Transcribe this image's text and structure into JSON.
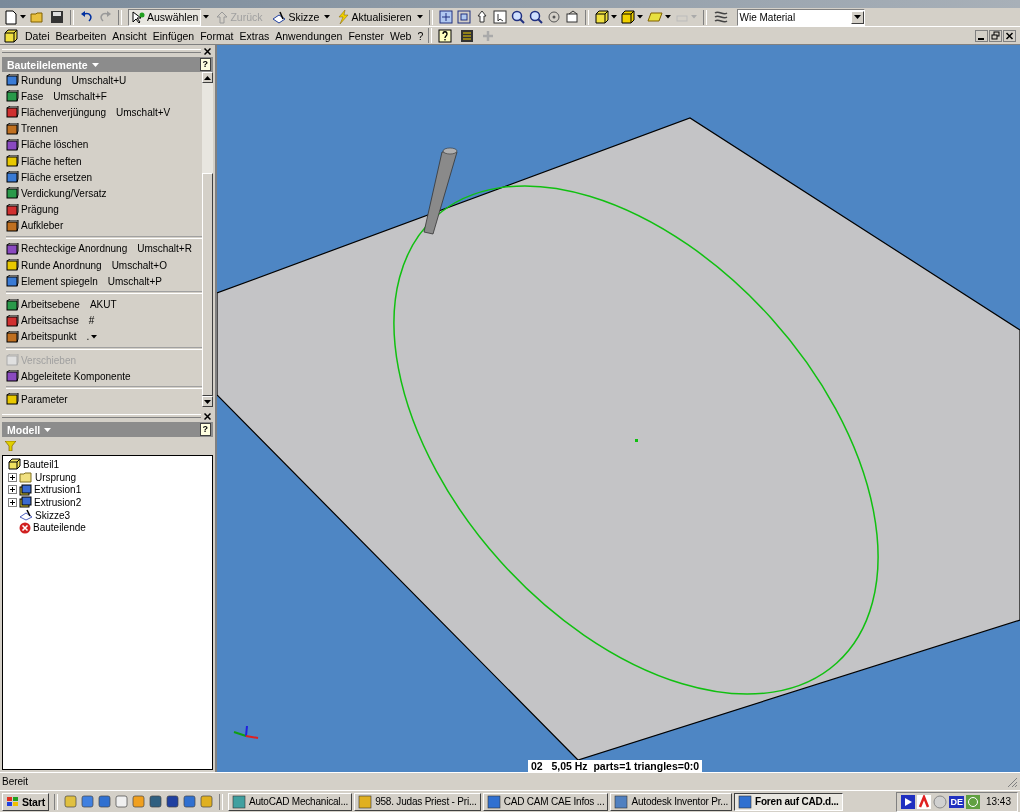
{
  "toolbar": {
    "buttons": [
      {
        "label": "Auswählen",
        "selected": true,
        "disabled": false
      },
      {
        "label": "Zurück",
        "selected": false,
        "disabled": true
      },
      {
        "label": "Skizze",
        "selected": false,
        "disabled": false
      },
      {
        "label": "Aktualisieren",
        "selected": false,
        "disabled": false
      }
    ],
    "material": {
      "value": "Wie Material"
    }
  },
  "menu": [
    "Datei",
    "Bearbeiten",
    "Ansicht",
    "Einfügen",
    "Format",
    "Extras",
    "Anwendungen",
    "Fenster",
    "Web",
    "?"
  ],
  "features_panel": {
    "title": "Bauteilelemente",
    "help": "?",
    "groups": [
      [
        {
          "label": "Rundung",
          "shortcut": "Umschalt+U",
          "disabled": false
        },
        {
          "label": "Fase",
          "shortcut": "Umschalt+F",
          "disabled": false
        },
        {
          "label": "Flächenverjüngung",
          "shortcut": "Umschalt+V",
          "disabled": false
        },
        {
          "label": "Trennen",
          "disabled": false
        },
        {
          "label": "Fläche löschen",
          "disabled": false
        },
        {
          "label": "Fläche heften",
          "disabled": false
        },
        {
          "label": "Fläche ersetzen",
          "disabled": false
        },
        {
          "label": "Verdickung/Versatz",
          "disabled": false
        },
        {
          "label": "Prägung",
          "disabled": false
        },
        {
          "label": "Aufkleber",
          "disabled": false
        }
      ],
      [
        {
          "label": "Rechteckige Anordnung",
          "shortcut": "Umschalt+R",
          "disabled": false
        },
        {
          "label": "Runde Anordnung",
          "shortcut": "Umschalt+O",
          "disabled": false
        },
        {
          "label": "Element spiegeln",
          "shortcut": "Umschalt+P",
          "disabled": false
        }
      ],
      [
        {
          "label": "Arbeitsebene",
          "shortcut": "AKUT",
          "disabled": false
        },
        {
          "label": "Arbeitsachse",
          "shortcut": "#",
          "disabled": false
        },
        {
          "label": "Arbeitspunkt",
          "shortcut": ".",
          "dropdown": true,
          "disabled": false
        }
      ],
      [
        {
          "label": "Verschieben",
          "disabled": true
        },
        {
          "label": "Abgeleitete Komponente",
          "disabled": false
        }
      ],
      [
        {
          "label": "Parameter",
          "disabled": false
        }
      ]
    ]
  },
  "model_panel": {
    "title": "Modell",
    "help": "?",
    "tree": [
      {
        "label": "Bauteil1",
        "kind": "part",
        "children": [
          {
            "label": "Ursprung",
            "kind": "folder",
            "expanded": false
          },
          {
            "label": "Extrusion1",
            "kind": "feature",
            "expanded": false
          },
          {
            "label": "Extrusion2",
            "kind": "feature",
            "expanded": false
          },
          {
            "label": "Skizze3",
            "kind": "sketch"
          },
          {
            "label": "Bauteilende",
            "kind": "end"
          }
        ]
      }
    ]
  },
  "viewport": {
    "info": "02   5,05 Hz  parts=1 triangles=0:0"
  },
  "status_bar": {
    "text": "Bereit"
  },
  "taskbar": {
    "start": "Start",
    "tasks": [
      {
        "label": "AutoCAD Mechanical...",
        "selected": false
      },
      {
        "label": "958. Judas Priest - Pri...",
        "selected": false
      },
      {
        "label": "CAD CAM CAE Infos ...",
        "selected": false
      },
      {
        "label": "Autodesk Inventor Pr...",
        "selected": false
      },
      {
        "label": "Foren auf CAD.d...",
        "selected": true
      }
    ],
    "language": "DE",
    "clock": "13:43"
  }
}
